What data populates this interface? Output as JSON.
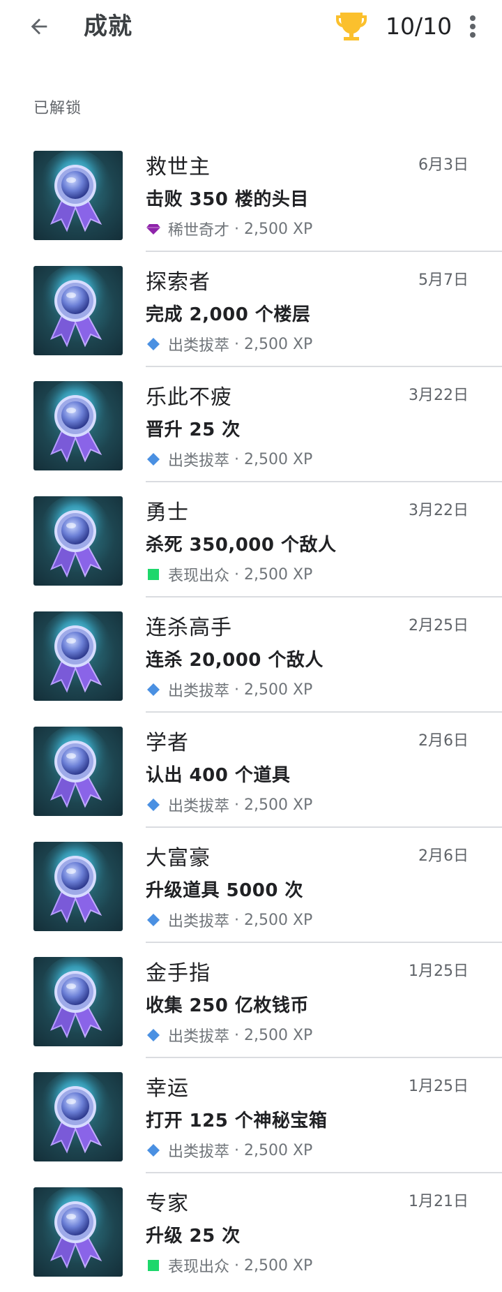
{
  "header": {
    "title": "成就",
    "progress": "10/10"
  },
  "section": {
    "title": "已解锁"
  },
  "colors": {
    "rarity_purple": "#8e24aa",
    "rarity_blue": "#4a90e2",
    "rarity_green": "#1ed76b",
    "trophy": "#fbc02d"
  },
  "achievements": [
    {
      "title": "救世主",
      "date": "6月3日",
      "desc": "击败 350 楼的头目",
      "rarity": "稀世奇才",
      "rarity_icon": "gem-icon",
      "xp": " · 2,500 XP"
    },
    {
      "title": "探索者",
      "date": "5月7日",
      "desc": "完成 2,000 个楼层",
      "rarity": "出类拔萃",
      "rarity_icon": "diamond-icon",
      "xp": " · 2,500 XP"
    },
    {
      "title": "乐此不疲",
      "date": "3月22日",
      "desc": "晋升 25 次",
      "rarity": "出类拔萃",
      "rarity_icon": "diamond-icon",
      "xp": " · 2,500 XP"
    },
    {
      "title": "勇士",
      "date": "3月22日",
      "desc": "杀死 350,000 个敌人",
      "rarity": "表现出众",
      "rarity_icon": "square-icon",
      "xp": " · 2,500 XP"
    },
    {
      "title": "连杀高手",
      "date": "2月25日",
      "desc": "连杀 20,000 个敌人",
      "rarity": "出类拔萃",
      "rarity_icon": "diamond-icon",
      "xp": " · 2,500 XP"
    },
    {
      "title": "学者",
      "date": "2月6日",
      "desc": "认出 400 个道具",
      "rarity": "出类拔萃",
      "rarity_icon": "diamond-icon",
      "xp": " · 2,500 XP"
    },
    {
      "title": "大富豪",
      "date": "2月6日",
      "desc": "升级道具 5000 次",
      "rarity": "出类拔萃",
      "rarity_icon": "diamond-icon",
      "xp": " · 2,500 XP"
    },
    {
      "title": "金手指",
      "date": "1月25日",
      "desc": "收集 250 亿枚钱币",
      "rarity": "出类拔萃",
      "rarity_icon": "diamond-icon",
      "xp": " · 2,500 XP"
    },
    {
      "title": "幸运",
      "date": "1月25日",
      "desc": "打开 125 个神秘宝箱",
      "rarity": "出类拔萃",
      "rarity_icon": "diamond-icon",
      "xp": " · 2,500 XP"
    },
    {
      "title": "专家",
      "date": "1月21日",
      "desc": "升级 25 次",
      "rarity": "表现出众",
      "rarity_icon": "square-icon",
      "xp": " · 2,500 XP"
    }
  ]
}
